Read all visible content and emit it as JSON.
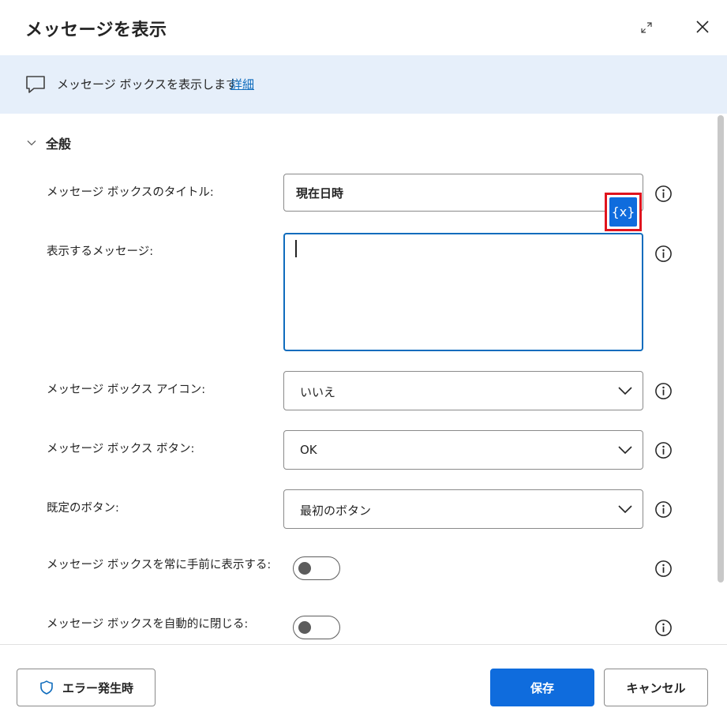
{
  "dialog": {
    "title": "メッセージを表示",
    "expand_icon": "expand-icon",
    "close_icon": "close-icon"
  },
  "banner": {
    "icon": "message-icon",
    "text": "メッセージ ボックスを表示します",
    "link": "詳細"
  },
  "section": {
    "title": "全般",
    "chevron_icon": "chevron-down-icon"
  },
  "fields": {
    "title": {
      "label": "メッセージ ボックスのタイトル:",
      "value": "現在日時"
    },
    "message": {
      "label": "表示するメッセージ:",
      "value": ""
    },
    "icon": {
      "label": "メッセージ ボックス アイコン:",
      "value": "いいえ"
    },
    "buttons": {
      "label": "メッセージ ボックス ボタン:",
      "value": "OK"
    },
    "default_button": {
      "label": "既定のボタン:",
      "value": "最初のボタン"
    },
    "always_on_top": {
      "label": "メッセージ ボックスを常に手前に表示する:",
      "checked": false
    },
    "auto_close": {
      "label": "メッセージ ボックスを自動的に閉じる:",
      "checked": false
    }
  },
  "variable_button": {
    "label": "{x}"
  },
  "footer": {
    "error_button": "エラー発生時",
    "save_button": "保存",
    "cancel_button": "キャンセル"
  },
  "colors": {
    "accent": "#0f6cdd",
    "banner_bg": "#e6effa",
    "highlight": "#e0141e"
  }
}
